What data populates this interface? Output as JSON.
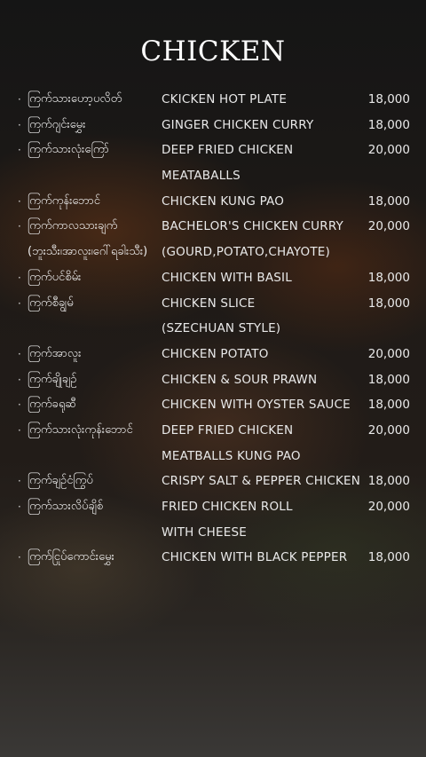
{
  "title": "CHICKEN",
  "items": [
    {
      "mm": "ကြက်သားဟော့ပလိတ်",
      "en": "CKICKEN HOT PLATE",
      "price": "18,000"
    },
    {
      "mm": "ကြက်ဂျင်းမွှေး",
      "en": "GINGER CHICKEN CURRY",
      "price": "18,000"
    },
    {
      "mm": "ကြက်သားလုံးကြော်",
      "en": "DEEP FRIED CHICKEN",
      "price": "20,000",
      "en2": "MEATABALLS"
    },
    {
      "mm": "ကြက်ကုန်းဘောင်",
      "en": "CHICKEN KUNG PAO",
      "price": "18,000"
    },
    {
      "mm": "ကြက်ကာလသားချက်",
      "en": "BACHELOR'S CHICKEN CURRY",
      "price": "20,000",
      "mm2": "(ဘူးသီး၊အာလူး၊ဂေါ်ရခါးသီး)",
      "en2": "(GOURD,POTATO,CHAYOTE)"
    },
    {
      "mm": "ကြက်ပင်စိမ်း",
      "en": "CHICKEN WITH BASIL",
      "price": "18,000"
    },
    {
      "mm": "ကြက်စီချွမ်",
      "en": "CHICKEN SLICE",
      "price": "18,000",
      "en2": "(SZECHUAN STYLE)"
    },
    {
      "mm": "ကြက်အာလူး",
      "en": "CHICKEN POTATO",
      "price": "20,000"
    },
    {
      "mm": "ကြက်ချိုချဉ်",
      "en": "CHICKEN & SOUR PRAWN",
      "price": "18,000"
    },
    {
      "mm": "ကြက်ခရုဆီ",
      "en": "CHICKEN WITH OYSTER SAUCE",
      "price": "18,000"
    },
    {
      "mm": "ကြက်သားလုံးကုန်းဘောင်",
      "en": "DEEP FRIED CHICKEN",
      "price": "20,000",
      "en2": "MEATBALLS KUNG PAO"
    },
    {
      "mm": "ကြက်ချဉ်ငံကြွပ်",
      "en": "CRISPY SALT & PEPPER CHICKEN",
      "price": "18,000"
    },
    {
      "mm": "ကြက်သားလိပ်ချိစ်",
      "en": "FRIED CHICKEN ROLL",
      "price": "20,000",
      "en2": "WITH CHEESE"
    },
    {
      "mm": "ကြက်ငြုပ်ကောင်းမွှေး",
      "en": "CHICKEN WITH BLACK PEPPER",
      "price": "18,000"
    }
  ]
}
